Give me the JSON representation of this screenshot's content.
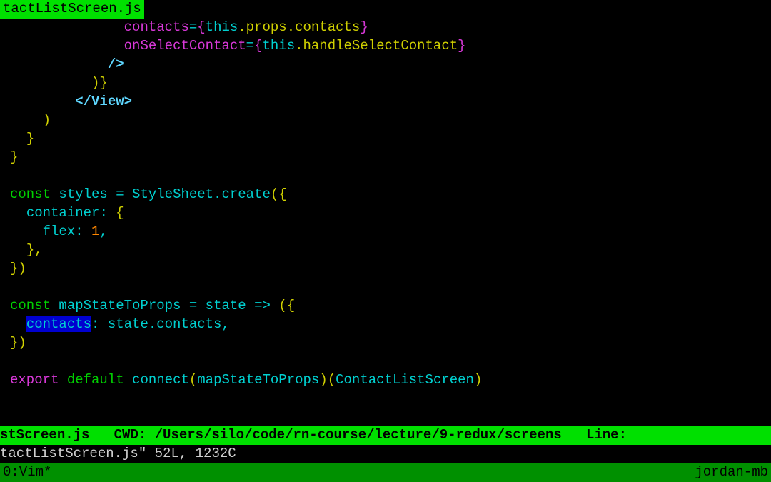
{
  "tab": {
    "filename": "tactListScreen.js"
  },
  "code": {
    "lines": [
      {
        "indent": "              ",
        "tokens": [
          {
            "t": "contacts",
            "c": "c-magenta"
          },
          {
            "t": "=",
            "c": "c-cyan"
          },
          {
            "t": "{",
            "c": "c-magenta"
          },
          {
            "t": "this",
            "c": "c-cyan"
          },
          {
            "t": ".props.contacts",
            "c": "c-yellow"
          },
          {
            "t": "}",
            "c": "c-magenta"
          }
        ]
      },
      {
        "indent": "              ",
        "tokens": [
          {
            "t": "onSelectContact",
            "c": "c-magenta"
          },
          {
            "t": "=",
            "c": "c-cyan"
          },
          {
            "t": "{",
            "c": "c-magenta"
          },
          {
            "t": "this",
            "c": "c-cyan"
          },
          {
            "t": ".handleSelectContact",
            "c": "c-yellow"
          },
          {
            "t": "}",
            "c": "c-magenta"
          }
        ]
      },
      {
        "indent": "            ",
        "tokens": [
          {
            "t": "/>",
            "c": "c-cyan-bold"
          }
        ]
      },
      {
        "indent": "          ",
        "tokens": [
          {
            "t": ")}",
            "c": "c-yellow"
          }
        ]
      },
      {
        "indent": "        ",
        "tokens": [
          {
            "t": "</View>",
            "c": "c-cyan-bold"
          }
        ]
      },
      {
        "indent": "    ",
        "tokens": [
          {
            "t": ")",
            "c": "c-yellow"
          }
        ]
      },
      {
        "indent": "  ",
        "tokens": [
          {
            "t": "}",
            "c": "c-yellow"
          }
        ]
      },
      {
        "indent": "",
        "tokens": [
          {
            "t": "}",
            "c": "c-yellow"
          }
        ]
      },
      {
        "indent": "",
        "tokens": []
      },
      {
        "indent": "",
        "tokens": [
          {
            "t": "const",
            "c": "c-green"
          },
          {
            "t": " styles ",
            "c": "c-cyan"
          },
          {
            "t": "=",
            "c": "c-cyan"
          },
          {
            "t": " StyleSheet.create",
            "c": "c-cyan"
          },
          {
            "t": "({",
            "c": "c-yellow"
          }
        ]
      },
      {
        "indent": "  ",
        "tokens": [
          {
            "t": "container",
            "c": "c-cyan"
          },
          {
            "t": ": ",
            "c": "c-cyan"
          },
          {
            "t": "{",
            "c": "c-yellow"
          }
        ]
      },
      {
        "indent": "    ",
        "tokens": [
          {
            "t": "flex",
            "c": "c-cyan"
          },
          {
            "t": ": ",
            "c": "c-cyan"
          },
          {
            "t": "1",
            "c": "c-orange"
          },
          {
            "t": ",",
            "c": "c-cyan"
          }
        ]
      },
      {
        "indent": "  ",
        "tokens": [
          {
            "t": "},",
            "c": "c-yellow"
          }
        ]
      },
      {
        "indent": "",
        "tokens": [
          {
            "t": "})",
            "c": "c-yellow"
          }
        ]
      },
      {
        "indent": "",
        "tokens": []
      },
      {
        "indent": "",
        "tokens": [
          {
            "t": "const",
            "c": "c-green"
          },
          {
            "t": " mapStateToProps ",
            "c": "c-cyan"
          },
          {
            "t": "=",
            "c": "c-cyan"
          },
          {
            "t": " state ",
            "c": "c-cyan"
          },
          {
            "t": "=>",
            "c": "c-cyan"
          },
          {
            "t": " ",
            "c": "c-cyan"
          },
          {
            "t": "({",
            "c": "c-yellow"
          }
        ]
      },
      {
        "indent": "  ",
        "tokens": [
          {
            "t": "contacts",
            "c": "c-cyan",
            "hl": true
          },
          {
            "t": ": state.contacts,",
            "c": "c-cyan"
          }
        ]
      },
      {
        "indent": "",
        "tokens": [
          {
            "t": "})",
            "c": "c-yellow"
          }
        ]
      },
      {
        "indent": "",
        "tokens": []
      },
      {
        "indent": "",
        "tokens": [
          {
            "t": "export",
            "c": "c-magenta"
          },
          {
            "t": " ",
            "c": ""
          },
          {
            "t": "default",
            "c": "c-green"
          },
          {
            "t": " connect",
            "c": "c-cyan"
          },
          {
            "t": "(",
            "c": "c-yellow"
          },
          {
            "t": "mapStateToProps",
            "c": "c-cyan"
          },
          {
            "t": ")(",
            "c": "c-yellow"
          },
          {
            "t": "ContactListScreen",
            "c": "c-cyan"
          },
          {
            "t": ")",
            "c": "c-yellow"
          }
        ]
      }
    ]
  },
  "status": {
    "filename": "stScreen.js",
    "cwd_label": "CWD:",
    "cwd_path": "/Users/silo/code/rn-course/lecture/9-redux/screens",
    "line_label": "Line:"
  },
  "message": {
    "text": "tactListScreen.js\" 52L, 1232C"
  },
  "tmux": {
    "left": "0:Vim*",
    "right": "jordan-mb"
  }
}
